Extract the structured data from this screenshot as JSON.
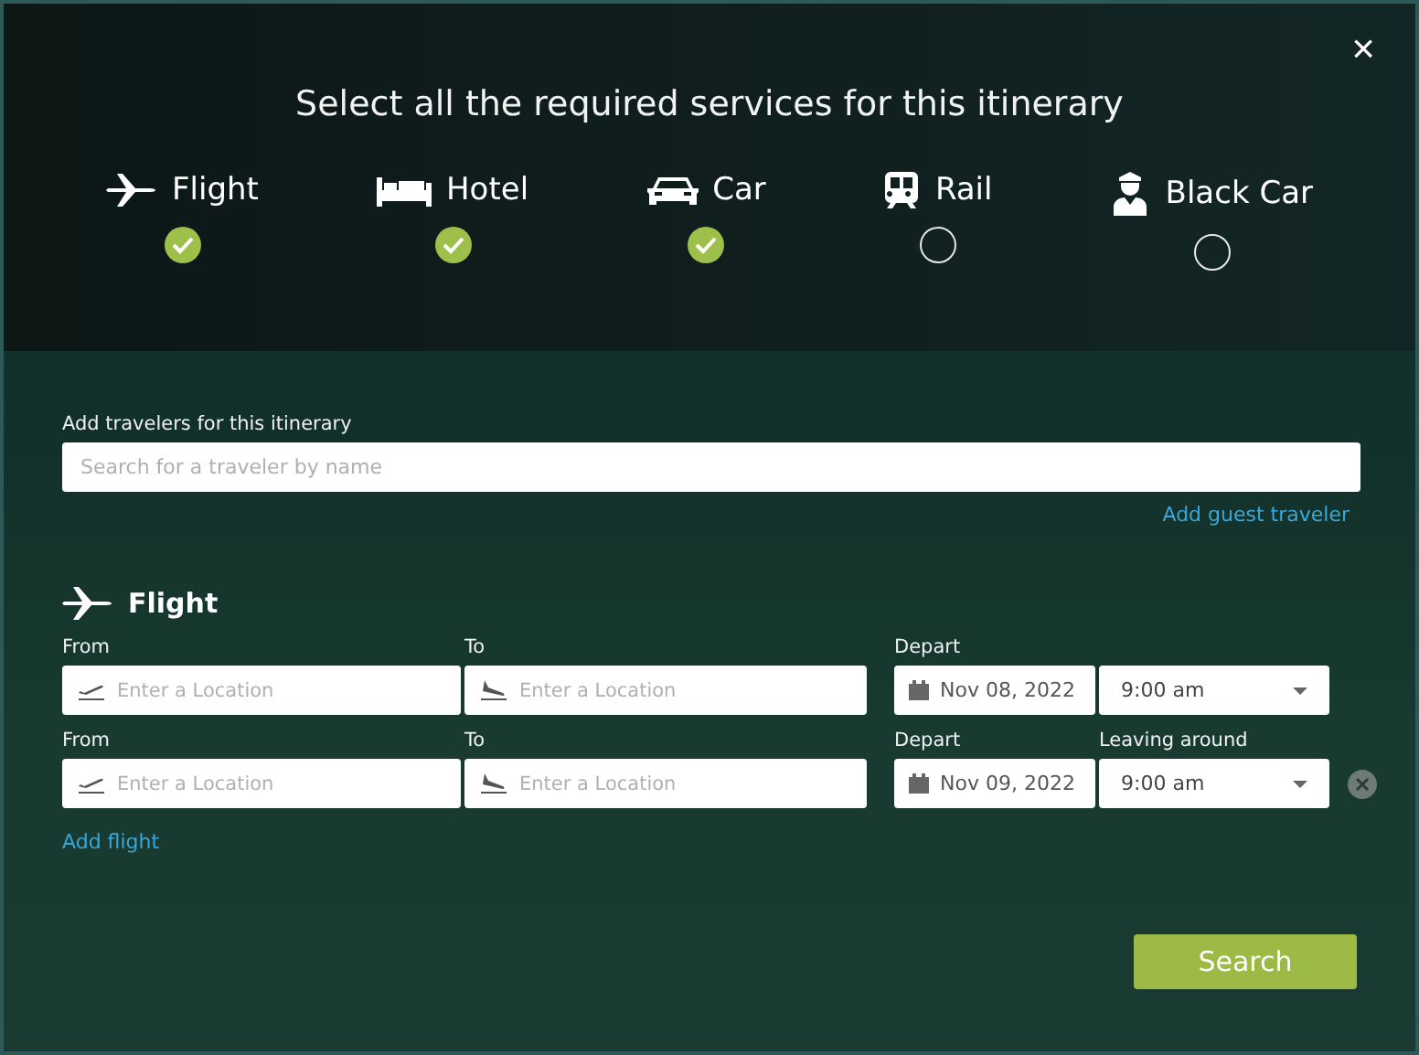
{
  "close": "×",
  "title": "Select all the required services for this itinerary",
  "services": [
    {
      "kind": "plane",
      "label": "Flight",
      "checked": true
    },
    {
      "kind": "bed",
      "label": "Hotel",
      "checked": true
    },
    {
      "kind": "car",
      "label": "Car",
      "checked": true
    },
    {
      "kind": "train",
      "label": "Rail",
      "checked": false
    },
    {
      "kind": "driver",
      "label": "Black Car",
      "checked": false
    }
  ],
  "travelers": {
    "label": "Add travelers for this itinerary",
    "placeholder": "Search for a traveler by name",
    "link": "Add guest traveler"
  },
  "flight": {
    "heading": "Flight",
    "legs": [
      {
        "from_label": "From",
        "from_placeholder": "Enter a Location",
        "to_label": "To",
        "to_placeholder": "Enter a Location",
        "date_label": "Depart",
        "date": "Nov 08, 2022",
        "time": "9:00 am",
        "removable": false
      },
      {
        "from_label": "From",
        "from_placeholder": "Enter a Location",
        "to_label": "To",
        "to_placeholder": "Enter a Location",
        "date_label": "Depart",
        "time_label": "Leaving around",
        "date": "Nov 09, 2022",
        "time": "9:00 am",
        "removable": true
      }
    ],
    "add_link": "Add flight"
  },
  "search_button": "Search"
}
